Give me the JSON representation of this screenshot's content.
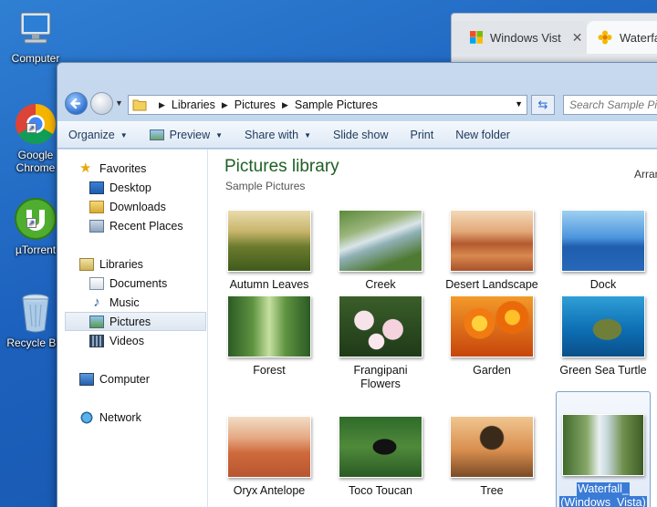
{
  "desktop": {
    "icons": [
      {
        "label": "Computer",
        "icon": "computer-icon"
      },
      {
        "label": "Google Chrome",
        "icon": "chrome-icon"
      },
      {
        "label": "µTorrent",
        "icon": "utorrent-icon"
      },
      {
        "label": "Recycle Bin",
        "icon": "recycle-bin-icon"
      }
    ]
  },
  "browser": {
    "tabs": [
      {
        "title": "Windows Vist",
        "close": "✕"
      },
      {
        "title": "Waterfal"
      }
    ]
  },
  "explorer": {
    "breadcrumb": [
      "Libraries",
      "Pictures",
      "Sample Pictures"
    ],
    "search_placeholder": "Search Sample Pictures",
    "toolbar": {
      "organize": "Organize",
      "preview": "Preview",
      "share_with": "Share with",
      "slide_show": "Slide show",
      "print": "Print",
      "new_folder": "New folder"
    },
    "sidebar": {
      "favorites": "Favorites",
      "desktop": "Desktop",
      "downloads": "Downloads",
      "recent_places": "Recent Places",
      "libraries": "Libraries",
      "documents": "Documents",
      "music": "Music",
      "pictures": "Pictures",
      "videos": "Videos",
      "computer": "Computer",
      "network": "Network"
    },
    "library_title": "Pictures library",
    "library_subtitle": "Sample Pictures",
    "arrange_label": "Arran",
    "pictures": [
      {
        "name": "Autumn Leaves"
      },
      {
        "name": "Creek"
      },
      {
        "name": "Desert Landscape"
      },
      {
        "name": "Dock"
      },
      {
        "name": "Forest"
      },
      {
        "name": "Frangipani Flowers",
        "line1": "Frangipani",
        "line2": "Flowers"
      },
      {
        "name": "Garden"
      },
      {
        "name": "Green Sea Turtle"
      },
      {
        "name": "Waterfall_(Windows_Vista)",
        "line1": "Waterfall_",
        "line2": "(Windows_Vista)",
        "selected": true
      },
      {
        "name": "Oryx Antelope"
      },
      {
        "name": "Toco Toucan"
      },
      {
        "name": "Tree"
      }
    ]
  }
}
